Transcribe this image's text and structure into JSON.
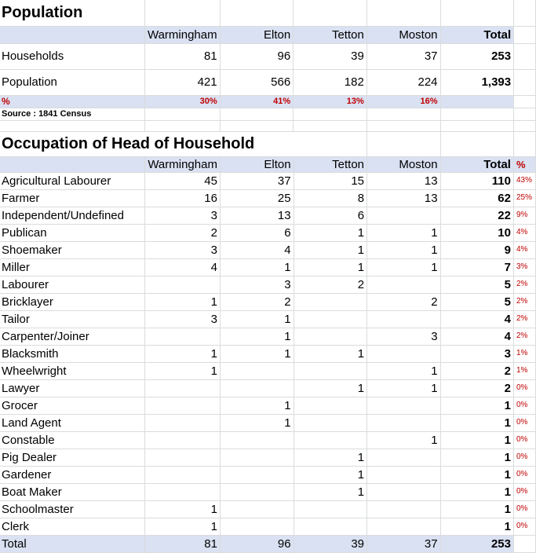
{
  "population": {
    "title": "Population",
    "headers": [
      "Warmingham",
      "Elton",
      "Tetton",
      "Moston",
      "Total"
    ],
    "households": {
      "label": "Households",
      "values": [
        "81",
        "96",
        "39",
        "37"
      ],
      "total": "253"
    },
    "population": {
      "label": "Population",
      "values": [
        "421",
        "566",
        "182",
        "224"
      ],
      "total": "1,393"
    },
    "pct": {
      "label": "%",
      "values": [
        "30%",
        "41%",
        "13%",
        "16%"
      ]
    },
    "source": "Source : 1841 Census"
  },
  "occupation": {
    "title": "Occupation of Head of Household",
    "headers": [
      "Warmingham",
      "Elton",
      "Tetton",
      "Moston",
      "Total",
      "%"
    ],
    "rows": [
      {
        "label": "Agricultural Labourer",
        "w": "45",
        "e": "37",
        "t": "15",
        "m": "13",
        "total": "110",
        "pct": "43%"
      },
      {
        "label": "Farmer",
        "w": "16",
        "e": "25",
        "t": "8",
        "m": "13",
        "total": "62",
        "pct": "25%"
      },
      {
        "label": "Independent/Undefined",
        "w": "3",
        "e": "13",
        "t": "6",
        "m": "",
        "total": "22",
        "pct": "9%"
      },
      {
        "label": "Publican",
        "w": "2",
        "e": "6",
        "t": "1",
        "m": "1",
        "total": "10",
        "pct": "4%"
      },
      {
        "label": "Shoemaker",
        "w": "3",
        "e": "4",
        "t": "1",
        "m": "1",
        "total": "9",
        "pct": "4%"
      },
      {
        "label": "Miller",
        "w": "4",
        "e": "1",
        "t": "1",
        "m": "1",
        "total": "7",
        "pct": "3%"
      },
      {
        "label": "Labourer",
        "w": "",
        "e": "3",
        "t": "2",
        "m": "",
        "total": "5",
        "pct": "2%"
      },
      {
        "label": "Bricklayer",
        "w": "1",
        "e": "2",
        "t": "",
        "m": "2",
        "total": "5",
        "pct": "2%"
      },
      {
        "label": "Tailor",
        "w": "3",
        "e": "1",
        "t": "",
        "m": "",
        "total": "4",
        "pct": "2%"
      },
      {
        "label": "Carpenter/Joiner",
        "w": "",
        "e": "1",
        "t": "",
        "m": "3",
        "total": "4",
        "pct": "2%"
      },
      {
        "label": "Blacksmith",
        "w": "1",
        "e": "1",
        "t": "1",
        "m": "",
        "total": "3",
        "pct": "1%"
      },
      {
        "label": "Wheelwright",
        "w": "1",
        "e": "",
        "t": "",
        "m": "1",
        "total": "2",
        "pct": "1%"
      },
      {
        "label": "Lawyer",
        "w": "",
        "e": "",
        "t": "1",
        "m": "1",
        "total": "2",
        "pct": "0%"
      },
      {
        "label": "Grocer",
        "w": "",
        "e": "1",
        "t": "",
        "m": "",
        "total": "1",
        "pct": "0%"
      },
      {
        "label": "Land Agent",
        "w": "",
        "e": "1",
        "t": "",
        "m": "",
        "total": "1",
        "pct": "0%"
      },
      {
        "label": "Constable",
        "w": "",
        "e": "",
        "t": "",
        "m": "1",
        "total": "1",
        "pct": "0%"
      },
      {
        "label": "Pig Dealer",
        "w": "",
        "e": "",
        "t": "1",
        "m": "",
        "total": "1",
        "pct": "0%"
      },
      {
        "label": "Gardener",
        "w": "",
        "e": "",
        "t": "1",
        "m": "",
        "total": "1",
        "pct": "0%"
      },
      {
        "label": "Boat Maker",
        "w": "",
        "e": "",
        "t": "1",
        "m": "",
        "total": "1",
        "pct": "0%"
      },
      {
        "label": "Schoolmaster",
        "w": "1",
        "e": "",
        "t": "",
        "m": "",
        "total": "1",
        "pct": "0%"
      },
      {
        "label": "Clerk",
        "w": "1",
        "e": "",
        "t": "",
        "m": "",
        "total": "1",
        "pct": "0%"
      }
    ],
    "total_row": {
      "label": "Total",
      "w": "81",
      "e": "96",
      "t": "39",
      "m": "37",
      "total": "253"
    }
  },
  "colors": {
    "band": "#d9e1f2",
    "pct_red": "#c00000",
    "gridline": "#dadcdd"
  }
}
